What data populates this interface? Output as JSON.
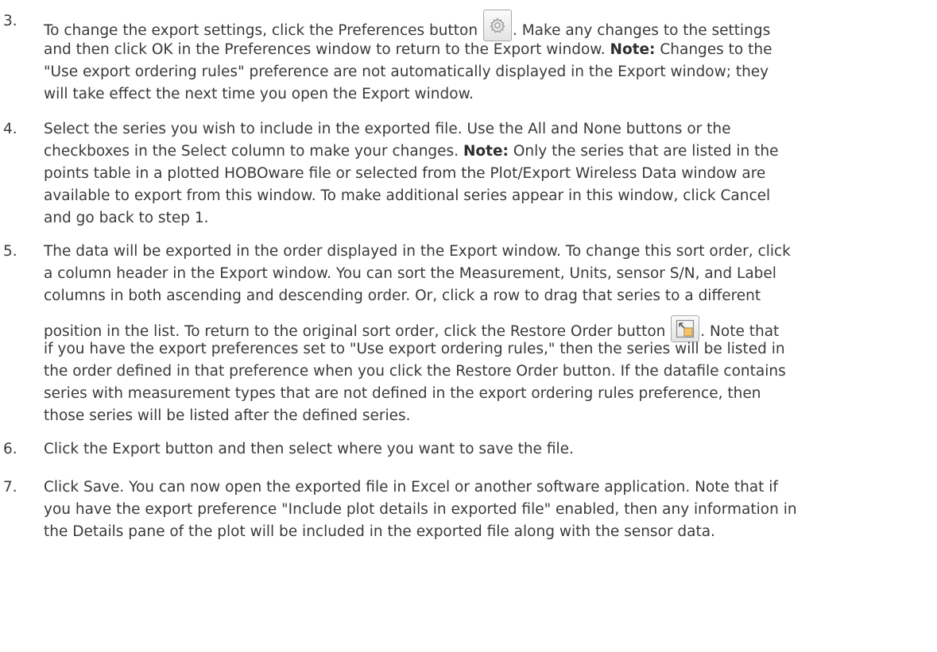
{
  "steps": [
    {
      "number": "3.",
      "lines": [
        {
          "segments": [
            "To change the export settings, click the Preferences button ",
            ". Make any changes to the settings"
          ]
        },
        {
          "segments": [
            "and then click OK in the Preferences window to return to the Export window. ",
            "Note:",
            " Changes to the"
          ]
        },
        {
          "segments": [
            "\"Use export ordering rules\" preference are not automatically displayed in the Export window; they"
          ]
        },
        {
          "segments": [
            "will take effect the next time you open the Export window."
          ]
        }
      ]
    },
    {
      "number": "4.",
      "lines": [
        {
          "segments": [
            "Select the series you wish to include in the exported file. Use the All and None buttons or the"
          ]
        },
        {
          "segments": [
            "checkboxes in the Select column to make your changes. ",
            "Note:",
            " Only the series that are listed in the"
          ]
        },
        {
          "segments": [
            "points table in a plotted HOBOware file or selected from the Plot/Export Wireless Data window are"
          ]
        },
        {
          "segments": [
            "available to export from this window. To make additional series appear in this window, click Cancel"
          ]
        },
        {
          "segments": [
            "and go back to step 1."
          ]
        }
      ]
    },
    {
      "number": "5.",
      "lines": [
        {
          "segments": [
            "The data will be exported in the order displayed in the Export window. To change this sort order, click"
          ]
        },
        {
          "segments": [
            "a column header in the Export window. You can sort the Measurement, Units, sensor S/N, and Label"
          ]
        },
        {
          "segments": [
            "columns in both ascending and descending order. Or, click a row to drag that series to a different"
          ]
        },
        {
          "segments": [
            "position in the list. To return to the original sort order, click the Restore Order button ",
            ". Note that"
          ]
        },
        {
          "segments": [
            "if you have the export preferences set to \"Use export ordering rules,\" then the series will be listed in"
          ]
        },
        {
          "segments": [
            "the order defined in that preference when you click the Restore Order button. If the datafile contains"
          ]
        },
        {
          "segments": [
            "series with measurement types that are not defined in the export ordering rules preference, then"
          ]
        },
        {
          "segments": [
            "those series will be listed after the defined series."
          ]
        }
      ]
    },
    {
      "number": "6.",
      "lines": [
        {
          "segments": [
            "Click the Export button and then select where you want to save the file."
          ]
        }
      ]
    },
    {
      "number": "7.",
      "lines": [
        {
          "segments": [
            "Click Save. You can now open the exported file in Excel or another software application. Note that if"
          ]
        },
        {
          "segments": [
            "you have the export preference \"Include plot details in exported file\" enabled, then any information in"
          ]
        },
        {
          "segments": [
            "the Details pane of the plot will be included in the exported file along with the sensor data."
          ]
        }
      ]
    }
  ],
  "icons": {
    "preferences": "gear-icon",
    "restore_order": "restore-order-icon"
  },
  "colors": {
    "text": "#3a3a3a",
    "restore_icon_fill": "#f5c46a"
  }
}
